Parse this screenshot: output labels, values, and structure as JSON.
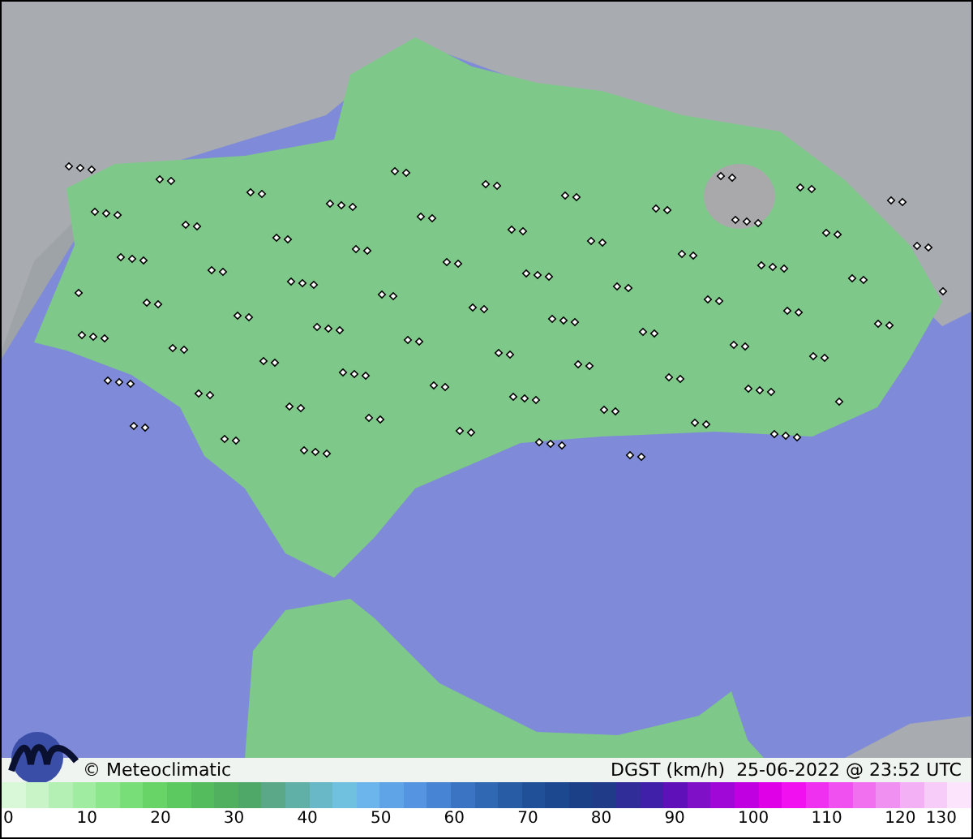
{
  "map": {
    "credit": "© Meteoclimatic",
    "variable": "DGST (km/h)",
    "timestamp": "25-06-2022 @ 23:52 UTC"
  },
  "legend": {
    "ticks": [
      "0",
      "10",
      "20",
      "30",
      "40",
      "50",
      "60",
      "70",
      "80",
      "90",
      "100",
      "110",
      "120",
      "130"
    ]
  }
}
